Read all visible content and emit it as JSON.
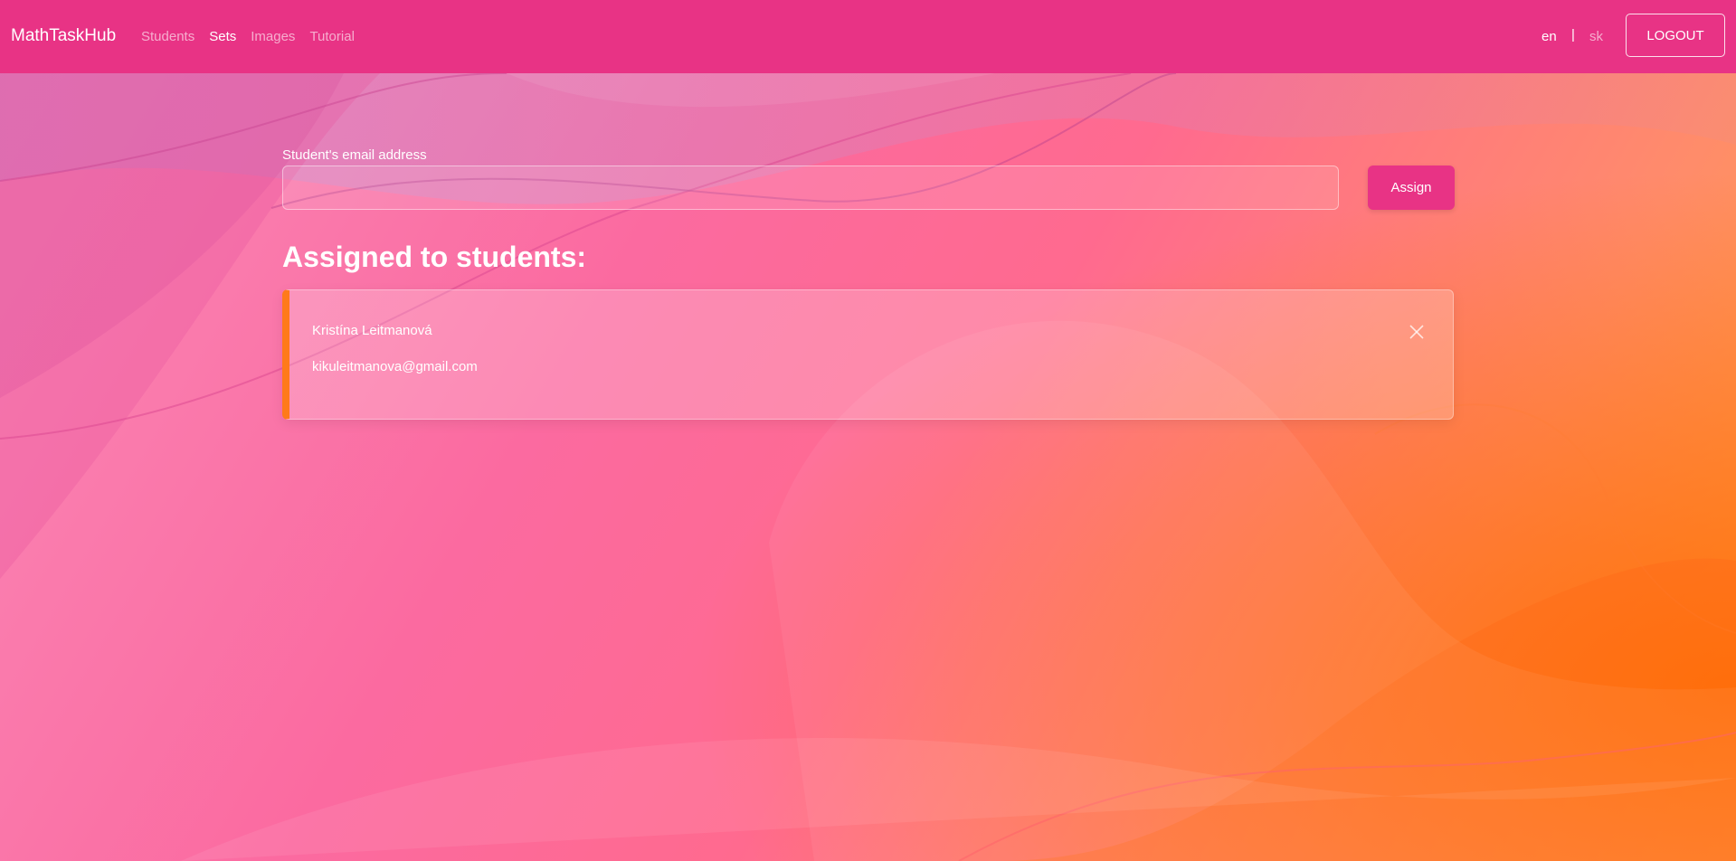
{
  "navbar": {
    "brand": "MathTaskHub",
    "links": [
      {
        "label": "Students",
        "active": false
      },
      {
        "label": "Sets",
        "active": true
      },
      {
        "label": "Images",
        "active": false
      },
      {
        "label": "Tutorial",
        "active": false
      }
    ],
    "languages": {
      "current": "en",
      "separator": "|",
      "other": "sk"
    },
    "logout_label": "LOGOUT"
  },
  "assign_form": {
    "label": "Student's email address",
    "value": "",
    "button_label": "Assign"
  },
  "assigned": {
    "title": "Assigned to students:",
    "students": [
      {
        "name": "Kristína Leitmanová",
        "email": "kikuleitmanova@gmail.com",
        "remove_icon": "close-icon"
      }
    ]
  },
  "colors": {
    "navbar": "#e83385",
    "card_accent": "#ff7a1a",
    "assign_button": "#e83385"
  }
}
